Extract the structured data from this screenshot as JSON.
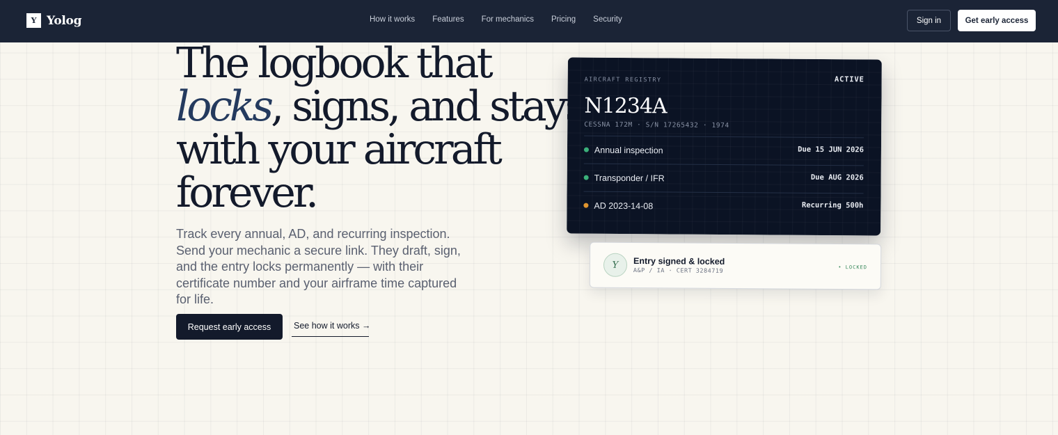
{
  "nav": {
    "brand_mark": "Y",
    "brand_name": "Yolog",
    "links": [
      "How it works",
      "Features",
      "For mechanics",
      "Pricing",
      "Security"
    ],
    "sign_in": "Sign in",
    "get_access": "Get early access"
  },
  "hero": {
    "headline": {
      "line1": "The logbook that",
      "emphasis": "locks",
      "line2_rest": ", signs, and stays",
      "line3": "with your aircraft",
      "line4": "forever."
    },
    "lede": "Track every annual, AD, and recurring inspection. Send your mechanic a secure link. They draft, sign, and the entry locks permanently — with their certificate number and your airframe time captured for life.",
    "primary_cta": "Request early access",
    "secondary_cta": "See how it works →"
  },
  "registry_card": {
    "label": "AIRCRAFT REGISTRY",
    "status": "ACTIVE",
    "tail_number": "N1234A",
    "meta": "CESSNA 172M · S/N 17265432 · 1974",
    "rows": [
      {
        "name": "Annual inspection",
        "due": "Due 15 JUN 2026",
        "status_color": "#3bb07a"
      },
      {
        "name": "Transponder / IFR",
        "due": "Due AUG 2026",
        "status_color": "#3bb07a"
      },
      {
        "name": "AD 2023-14-08",
        "due": "Recurring 500h",
        "status_color": "#e0952f"
      }
    ]
  },
  "signed_card": {
    "avatar_letter": "Y",
    "title": "Entry signed & locked",
    "subtitle": "A&P / IA · CERT 3284719",
    "badge": "• LOCKED"
  },
  "colors": {
    "nav_bg": "#1b2436",
    "ink": "#131a2b",
    "accent": "#243a5e",
    "page_bg": "#f8f6ef"
  }
}
